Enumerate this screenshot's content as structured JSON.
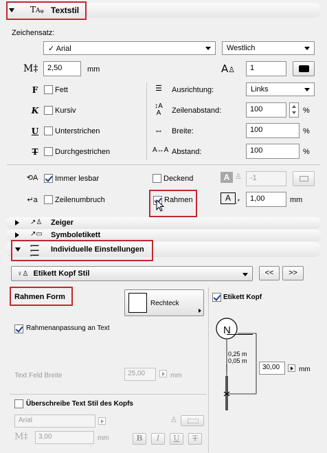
{
  "textstil": {
    "title": "Textstil",
    "zeichensatz_label": "Zeichensatz:",
    "font_check": "✓",
    "font_value": "Arial",
    "script_value": "Westlich",
    "size_value": "2,50",
    "size_unit": "mm",
    "pen_value": "1",
    "fett": "Fett",
    "kursiv": "Kursiv",
    "unterstrichen": "Unterstrichen",
    "durchgestrichen": "Durchgestrichen",
    "ausrichtung_label": "Ausrichtung:",
    "ausrichtung_value": "Links",
    "zeilenabstand_label": "Zeilenabstand:",
    "zeilenabstand_value": "100",
    "breite_label": "Breite:",
    "breite_value": "100",
    "abstand_label": "Abstand:",
    "abstand_value": "100",
    "percent": "%",
    "immer_lesbar": "Immer lesbar",
    "deckend": "Deckend",
    "deckend_pen": "-1",
    "zeilenumbruch": "Zeilenumbruch",
    "rahmen": "Rahmen",
    "rahmen_offset": "1,00",
    "rahmen_unit": "mm"
  },
  "zeiger": {
    "title": "Zeiger"
  },
  "symboletikett": {
    "title": "Symboletikett"
  },
  "individuelle": {
    "title": "Individuelle Einstellungen",
    "style_value": "Etikett Kopf Stil",
    "prev": "<<",
    "next": ">>",
    "rahmen_form": "Rahmen Form",
    "shape_label": "Rechteck",
    "anpassung": "Rahmenanpassung an Text",
    "feld_breite_label": "Text Feld Breite",
    "feld_breite_value": "25,00",
    "unit": "mm",
    "etikett_kopf": "Etikett Kopf",
    "head_letter": "N",
    "dim1": "0,25 m",
    "dim2": "0,05 m",
    "head_width": "30,00",
    "ueberschreibe": "Überschreibe Text Stil des Kopfs",
    "font2": "Arial",
    "size2": "3,00",
    "b": "B",
    "i": "I",
    "u": "U",
    "t": "T"
  }
}
